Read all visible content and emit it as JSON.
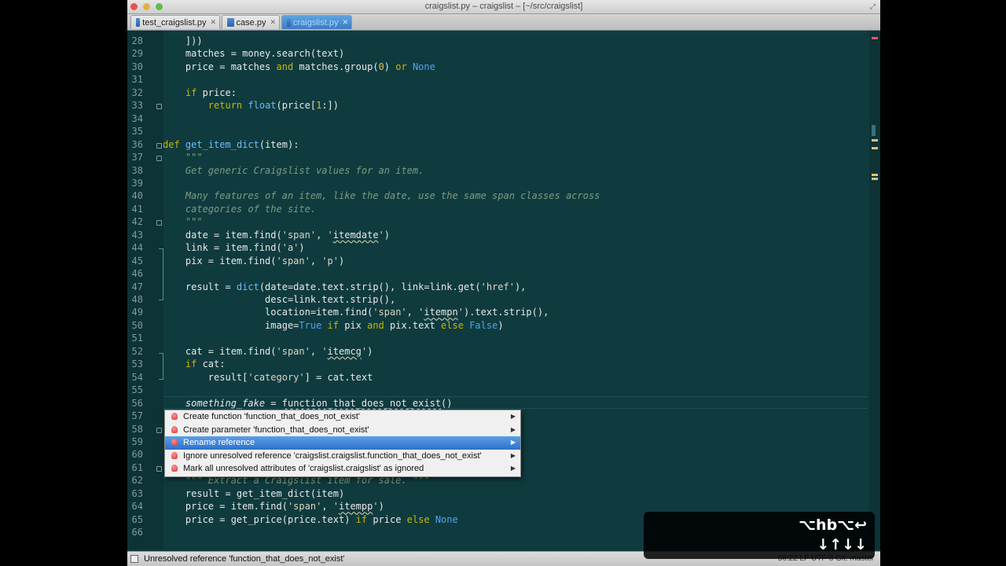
{
  "window": {
    "title": "craigslist.py – craigslist – [~/src/craigslist]",
    "traffic_lights": [
      "#e5554f",
      "#e0b23f",
      "#5ebe4b"
    ]
  },
  "tabs": [
    {
      "label": "test_craigslist.py",
      "active": false
    },
    {
      "label": "case.py",
      "active": false
    },
    {
      "label": "craigslist.py",
      "active": true
    }
  ],
  "editor": {
    "lines": [
      {
        "n": "28",
        "tokens": [
          [
            "plain",
            "    ]))"
          ]
        ]
      },
      {
        "n": "29",
        "tokens": [
          [
            "plain",
            "    matches = money.search(text)"
          ]
        ]
      },
      {
        "n": "30",
        "tokens": [
          [
            "plain",
            "    price = matches "
          ],
          [
            "kw",
            "and"
          ],
          [
            "plain",
            " matches.group("
          ],
          [
            "num",
            "0"
          ],
          [
            "plain",
            ") "
          ],
          [
            "kw",
            "or"
          ],
          [
            "plain",
            " "
          ],
          [
            "const",
            "None"
          ]
        ]
      },
      {
        "n": "31",
        "tokens": []
      },
      {
        "n": "32",
        "tokens": [
          [
            "plain",
            "    "
          ],
          [
            "kw",
            "if"
          ],
          [
            "plain",
            " price:"
          ]
        ]
      },
      {
        "n": "33",
        "tokens": [
          [
            "plain",
            "        "
          ],
          [
            "kw",
            "return"
          ],
          [
            "plain",
            " "
          ],
          [
            "fn",
            "float"
          ],
          [
            "plain",
            "(price["
          ],
          [
            "num",
            "1"
          ],
          [
            "plain",
            ":])"
          ]
        ]
      },
      {
        "n": "34",
        "tokens": []
      },
      {
        "n": "35",
        "tokens": []
      },
      {
        "n": "36",
        "tokens": [
          [
            "kw",
            "def"
          ],
          [
            "plain",
            " "
          ],
          [
            "fn",
            "get_item_dict"
          ],
          [
            "plain",
            "(item):"
          ]
        ]
      },
      {
        "n": "37",
        "tokens": [
          [
            "plain",
            "    "
          ],
          [
            "doc",
            "\"\"\""
          ]
        ]
      },
      {
        "n": "38",
        "tokens": [
          [
            "plain",
            "    "
          ],
          [
            "doc",
            "Get generic Craigslist values for an item."
          ]
        ]
      },
      {
        "n": "39",
        "tokens": []
      },
      {
        "n": "40",
        "tokens": [
          [
            "plain",
            "    "
          ],
          [
            "doc",
            "Many features of an item, like the date, use the same span classes across"
          ]
        ]
      },
      {
        "n": "41",
        "tokens": [
          [
            "plain",
            "    "
          ],
          [
            "doc",
            "categories of the site."
          ]
        ]
      },
      {
        "n": "42",
        "tokens": [
          [
            "plain",
            "    "
          ],
          [
            "doc",
            "\"\"\""
          ]
        ]
      },
      {
        "n": "43",
        "tokens": [
          [
            "plain",
            "    date = item.find("
          ],
          [
            "str",
            "'span'"
          ],
          [
            "plain",
            ", "
          ],
          [
            "str",
            "'"
          ],
          [
            "err",
            "itemdate"
          ],
          [
            "str",
            "'"
          ],
          [
            "plain",
            ")"
          ]
        ]
      },
      {
        "n": "44",
        "tokens": [
          [
            "plain",
            "    link = item.find("
          ],
          [
            "str",
            "'a'"
          ],
          [
            "plain",
            ")"
          ]
        ]
      },
      {
        "n": "45",
        "tokens": [
          [
            "plain",
            "    pix = item.find("
          ],
          [
            "str",
            "'span'"
          ],
          [
            "plain",
            ", "
          ],
          [
            "str",
            "'p'"
          ],
          [
            "plain",
            ")"
          ]
        ]
      },
      {
        "n": "46",
        "tokens": []
      },
      {
        "n": "47",
        "tokens": [
          [
            "plain",
            "    result = "
          ],
          [
            "fn",
            "dict"
          ],
          [
            "plain",
            "(date=date.text.strip(), link=link.get("
          ],
          [
            "str",
            "'href'"
          ],
          [
            "plain",
            "),"
          ]
        ]
      },
      {
        "n": "48",
        "tokens": [
          [
            "plain",
            "                  desc=link.text.strip(),"
          ]
        ]
      },
      {
        "n": "49",
        "tokens": [
          [
            "plain",
            "                  location=item.find("
          ],
          [
            "str",
            "'span'"
          ],
          [
            "plain",
            ", "
          ],
          [
            "str",
            "'"
          ],
          [
            "err",
            "itempn"
          ],
          [
            "str",
            "'"
          ],
          [
            "plain",
            ").text.strip(),"
          ]
        ]
      },
      {
        "n": "50",
        "tokens": [
          [
            "plain",
            "                  image="
          ],
          [
            "const",
            "True"
          ],
          [
            "plain",
            " "
          ],
          [
            "kw",
            "if"
          ],
          [
            "plain",
            " pix "
          ],
          [
            "kw",
            "and"
          ],
          [
            "plain",
            " pix.text "
          ],
          [
            "kw",
            "else"
          ],
          [
            "plain",
            " "
          ],
          [
            "const",
            "False"
          ],
          [
            "plain",
            ")"
          ]
        ]
      },
      {
        "n": "51",
        "tokens": []
      },
      {
        "n": "52",
        "tokens": [
          [
            "plain",
            "    cat = item.find("
          ],
          [
            "str",
            "'span'"
          ],
          [
            "plain",
            ", "
          ],
          [
            "str",
            "'"
          ],
          [
            "err",
            "itemcg"
          ],
          [
            "str",
            "'"
          ],
          [
            "plain",
            ")"
          ]
        ]
      },
      {
        "n": "53",
        "tokens": [
          [
            "plain",
            "    "
          ],
          [
            "kw",
            "if"
          ],
          [
            "plain",
            " cat:"
          ]
        ]
      },
      {
        "n": "54",
        "tokens": [
          [
            "plain",
            "        result["
          ],
          [
            "str",
            "'category'"
          ],
          [
            "plain",
            "] = cat.text"
          ]
        ]
      },
      {
        "n": "55",
        "tokens": []
      },
      {
        "n": "56",
        "tokens": [
          [
            "plain",
            "    "
          ],
          [
            "it",
            "something_fake"
          ],
          [
            "plain",
            " = "
          ],
          [
            "unres",
            "function_that_does_not_exist"
          ],
          [
            "plain",
            "()"
          ]
        ]
      },
      {
        "n": "57",
        "tokens": []
      },
      {
        "n": "58",
        "tokens": []
      },
      {
        "n": "59",
        "tokens": []
      },
      {
        "n": "60",
        "tokens": []
      },
      {
        "n": "61",
        "tokens": []
      },
      {
        "n": "62",
        "tokens": [
          [
            "plain",
            "    "
          ],
          [
            "doc",
            "\"\"\" Extract a Craigslist item for sale. \"\"\""
          ]
        ]
      },
      {
        "n": "63",
        "tokens": [
          [
            "plain",
            "    result = get_item_dict(item)"
          ]
        ]
      },
      {
        "n": "64",
        "tokens": [
          [
            "plain",
            "    price = item.find("
          ],
          [
            "str",
            "'span'"
          ],
          [
            "plain",
            ", "
          ],
          [
            "str",
            "'"
          ],
          [
            "err",
            "itempp"
          ],
          [
            "str",
            "'"
          ],
          [
            "plain",
            ")"
          ]
        ]
      },
      {
        "n": "65",
        "tokens": [
          [
            "plain",
            "    price = get_price(price.text) "
          ],
          [
            "kw",
            "if"
          ],
          [
            "plain",
            " price "
          ],
          [
            "kw",
            "else"
          ],
          [
            "plain",
            " "
          ],
          [
            "const",
            "None"
          ]
        ]
      },
      {
        "n": "66",
        "tokens": []
      }
    ],
    "fold_markers": [
      "33",
      "36",
      "37",
      "42",
      "58",
      "61"
    ]
  },
  "intention_popup": {
    "items": [
      {
        "label": "Create function 'function_that_does_not_exist'",
        "selected": false
      },
      {
        "label": "Create parameter 'function_that_does_not_exist'",
        "selected": false
      },
      {
        "label": "Rename reference",
        "selected": true
      },
      {
        "label": "Ignore unresolved reference 'craigslist.craigslist.function_that_does_not_exist'",
        "selected": false
      },
      {
        "label": "Mark all unresolved attributes of 'craigslist.craigslist' as ignored",
        "selected": false
      }
    ]
  },
  "status_bar": {
    "message": "Unresolved reference 'function_that_does_not_exist'",
    "right": "56:22   LF   UTF-8   Git: master"
  },
  "keycast": {
    "line1": "⌥hb⌥↩",
    "line2": "↓↑↓↓"
  },
  "icons": {
    "tab_file": "python-file-icon",
    "tab_close": "close-icon",
    "popup_bulb": "lightbulb-icon",
    "popup_arrow": "chevron-right-icon"
  },
  "colors": {
    "editor_bg": "#0f3b3f",
    "keyword": "#c9b600",
    "constant": "#4fa3ee",
    "docstring": "#7f9a82",
    "selection": "#3b7cc4"
  }
}
